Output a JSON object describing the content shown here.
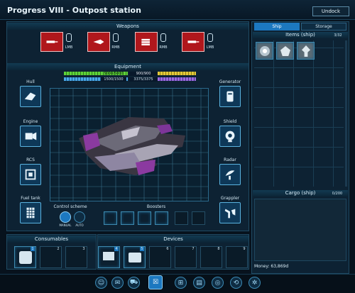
{
  "window": {
    "title": "Progress VIII - Outpost station",
    "undock_label": "Undock"
  },
  "weapons": {
    "header": "Weapons",
    "slots": [
      {
        "badge": "LMB",
        "type": "laser"
      },
      {
        "badge": "RMB",
        "type": "rocket"
      },
      {
        "badge": "RMB",
        "type": "rocket"
      },
      {
        "badge": "LMB",
        "type": "laser"
      }
    ]
  },
  "equipment": {
    "header": "Equipment",
    "stats": {
      "hull": "5000/5000",
      "energy": "900/900",
      "shield": "1500/1500",
      "cargo": "3375/3375"
    },
    "slot_labels": {
      "hull": "Hull",
      "engine": "Engine",
      "rcs": "RCS",
      "fuel_tank": "Fuel tank",
      "generator": "Generator",
      "shield": "Shield",
      "radar": "Radar",
      "grappler": "Grappler"
    },
    "control_scheme_label": "Control scheme",
    "control_modes": [
      "MANUAL",
      "AUTO"
    ],
    "boosters_label": "Boosters"
  },
  "consumables": {
    "header": "Consumables",
    "slot_numbers": [
      "1",
      "2",
      "3"
    ]
  },
  "devices": {
    "header": "Devices",
    "slot_numbers": [
      "4",
      "5",
      "6",
      "7",
      "8",
      "9"
    ]
  },
  "right_panel": {
    "tabs": [
      "Ship",
      "Storage"
    ],
    "items_header": "Items (ship)",
    "items_count": "3/32",
    "cargo_header": "Cargo (ship)",
    "cargo_count": "0/200",
    "money": "Money: 63,869d"
  },
  "colors": {
    "accent": "#1c78c0",
    "hull": "#5fd33a",
    "energy": "#e3c93a",
    "shield": "#4aa8e8",
    "cargo": "#9a6ce0"
  },
  "bottom_nav": [
    "chat-icon",
    "message-icon",
    "cart-icon",
    "hangar-icon",
    "map-icon",
    "journal-icon",
    "target-icon",
    "share-icon",
    "settings-icon"
  ]
}
